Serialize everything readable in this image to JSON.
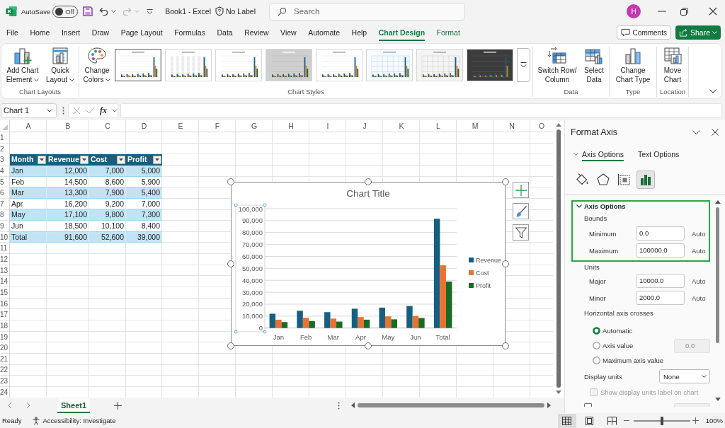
{
  "title_bar": {
    "autosave_label": "AutoSave",
    "autosave": {
      "on": false,
      "label": "Off"
    },
    "document_title": "Book1 - Excel",
    "sensitivity": "No Label",
    "search": {
      "placeholder": "Search"
    },
    "avatar": "H"
  },
  "tabs": [
    {
      "label": "File",
      "selected": false,
      "contextual": false
    },
    {
      "label": "Home",
      "selected": false,
      "contextual": false
    },
    {
      "label": "Insert",
      "selected": false,
      "contextual": false
    },
    {
      "label": "Draw",
      "selected": false,
      "contextual": false
    },
    {
      "label": "Page Layout",
      "selected": false,
      "contextual": false
    },
    {
      "label": "Formulas",
      "selected": false,
      "contextual": false
    },
    {
      "label": "Data",
      "selected": false,
      "contextual": false
    },
    {
      "label": "Review",
      "selected": false,
      "contextual": false
    },
    {
      "label": "View",
      "selected": false,
      "contextual": false
    },
    {
      "label": "Automate",
      "selected": false,
      "contextual": false
    },
    {
      "label": "Help",
      "selected": false,
      "contextual": false
    },
    {
      "label": "Chart Design",
      "selected": true,
      "contextual": true
    },
    {
      "label": "Format",
      "selected": false,
      "contextual": true
    }
  ],
  "header_buttons": {
    "comments": "Comments",
    "share": "Share"
  },
  "ribbon": {
    "groups": [
      {
        "label": "Chart Layouts",
        "buttons": [
          {
            "label": "Add Chart Element",
            "kind": "add-element",
            "menu": true
          },
          {
            "label": "Quick Layout",
            "kind": "quick-layout",
            "menu": true
          }
        ]
      },
      {
        "label": "Chart Styles",
        "buttons": [
          {
            "label": "Change Colors",
            "kind": "colors",
            "menu": true
          }
        ],
        "gallery": [
          {
            "kind": "plain",
            "selected": true
          },
          {
            "kind": "banded",
            "selected": false
          },
          {
            "kind": "plain",
            "selected": false
          },
          {
            "kind": "gray",
            "selected": false
          },
          {
            "kind": "plain",
            "selected": false
          },
          {
            "kind": "gridded",
            "selected": false
          },
          {
            "kind": "hatched",
            "selected": false
          },
          {
            "kind": "dark",
            "selected": false
          }
        ]
      },
      {
        "label": "Data",
        "buttons": [
          {
            "label": "Switch Row/Column",
            "kind": "switch",
            "menu": false
          },
          {
            "label": "Select Data",
            "kind": "select-data",
            "menu": false
          }
        ]
      },
      {
        "label": "Type",
        "buttons": [
          {
            "label": "Change Chart Type",
            "kind": "chart-type",
            "menu": false
          }
        ]
      },
      {
        "label": "Location",
        "buttons": [
          {
            "label": "Move Chart",
            "kind": "move",
            "menu": false
          }
        ]
      }
    ]
  },
  "formula_bar": {
    "name_box": "Chart 1",
    "function_button": "fx"
  },
  "sheet": {
    "columns": [
      "A",
      "B",
      "C",
      "D",
      "E",
      "F",
      "G",
      "H",
      "I",
      "J",
      "K",
      "L",
      "M",
      "N",
      "O"
    ],
    "rows": [
      "1",
      "2",
      "3",
      "4",
      "5",
      "6",
      "7",
      "8",
      "9",
      "10",
      "11",
      "12",
      "13",
      "14",
      "15",
      "16",
      "17",
      "18",
      "19",
      "20",
      "21",
      "22",
      "23",
      "24"
    ],
    "table": {
      "header": [
        "Month",
        "Revenue",
        "Cost",
        "Profit"
      ],
      "rows": [
        {
          "banded": true,
          "cells": [
            "Jan",
            "12,000",
            "7,000",
            "5,000"
          ]
        },
        {
          "banded": false,
          "cells": [
            "Feb",
            "14,500",
            "8,600",
            "5,900"
          ]
        },
        {
          "banded": true,
          "cells": [
            "Mar",
            "13,300",
            "7,900",
            "5,400"
          ]
        },
        {
          "banded": false,
          "cells": [
            "Apr",
            "16,200",
            "9,200",
            "7,000"
          ]
        },
        {
          "banded": true,
          "cells": [
            "May",
            "17,100",
            "9,800",
            "7,300"
          ]
        },
        {
          "banded": false,
          "cells": [
            "Jun",
            "18,500",
            "10,100",
            "8,400"
          ]
        },
        {
          "banded": true,
          "cells": [
            "Total",
            "91,600",
            "52,600",
            "39,000"
          ]
        }
      ]
    },
    "chart_data": {
      "type": "bar",
      "title": "Chart Title",
      "categories": [
        "Jan",
        "Feb",
        "Mar",
        "Apr",
        "May",
        "Jun",
        "Total"
      ],
      "series": [
        {
          "name": "Revenue",
          "color": "#156082",
          "values": [
            12000,
            14500,
            13300,
            16200,
            17100,
            18500,
            91600
          ]
        },
        {
          "name": "Cost",
          "color": "#e97132",
          "values": [
            7000,
            8600,
            7900,
            9200,
            9800,
            10100,
            52600
          ]
        },
        {
          "name": "Profit",
          "color": "#196b24",
          "values": [
            5000,
            5900,
            5400,
            7000,
            7300,
            8400,
            39000
          ]
        }
      ],
      "ylim": [
        0,
        100000
      ],
      "yticks": [
        {
          "value": 0,
          "label": "0"
        },
        {
          "value": 10000,
          "label": "10,000"
        },
        {
          "value": 20000,
          "label": "20,000"
        },
        {
          "value": 30000,
          "label": "30,000"
        },
        {
          "value": 40000,
          "label": "40,000"
        },
        {
          "value": 50000,
          "label": "50,000"
        },
        {
          "value": 60000,
          "label": "60,000"
        },
        {
          "value": 70000,
          "label": "70,000"
        },
        {
          "value": 80000,
          "label": "80,000"
        },
        {
          "value": 90000,
          "label": "90,000"
        },
        {
          "value": 100000,
          "label": "100,000"
        }
      ],
      "grid": true,
      "legend": "right"
    }
  },
  "sheet_tabs": [
    {
      "label": "Sheet1",
      "selected": true
    }
  ],
  "format_pane": {
    "title": "Format Axis",
    "tabs": [
      {
        "label": "Axis Options",
        "selected": true,
        "menu": true
      },
      {
        "label": "Text Options",
        "selected": false,
        "menu": false
      }
    ],
    "icon_tabs": [
      {
        "kind": "fill",
        "selected": false
      },
      {
        "kind": "effects",
        "selected": false
      },
      {
        "kind": "size",
        "selected": false
      },
      {
        "kind": "axis",
        "selected": true
      }
    ],
    "section": {
      "title": "Axis Options",
      "expanded": true,
      "highlighted": true,
      "groups": [
        {
          "title": "Bounds",
          "fields": [
            {
              "label": "Minimum",
              "value": "0.0",
              "status": "Auto"
            },
            {
              "label": "Maximum",
              "value": "100000.0",
              "status": "Auto"
            }
          ]
        },
        {
          "title": "Units",
          "fields": [
            {
              "label": "Major",
              "value": "10000.0",
              "status": "Auto"
            },
            {
              "label": "Minor",
              "value": "2000.0",
              "status": "Auto"
            }
          ]
        }
      ],
      "crosses": {
        "title": "Horizontal axis crosses",
        "options": [
          {
            "label": "Automatic",
            "selected": true
          },
          {
            "label": "Axis value",
            "selected": false,
            "value": "0.0",
            "disabled": true
          },
          {
            "label": "Maximum axis value",
            "selected": false
          }
        ]
      },
      "display_units": {
        "label": "Display units",
        "value": "None"
      },
      "checkboxes": [
        {
          "label": "Show display units label on chart",
          "checked": false,
          "disabled": true
        },
        {
          "checked": false,
          "disabled": false
        }
      ]
    }
  },
  "status_bar": {
    "status": "Ready",
    "accessibility": "Accessibility: Investigate",
    "views": [
      {
        "kind": "normal",
        "selected": true
      },
      {
        "kind": "page-layout",
        "selected": false
      },
      {
        "kind": "page-break",
        "selected": false
      }
    ],
    "zoom": {
      "level": 0.5,
      "reading": "100%"
    }
  }
}
